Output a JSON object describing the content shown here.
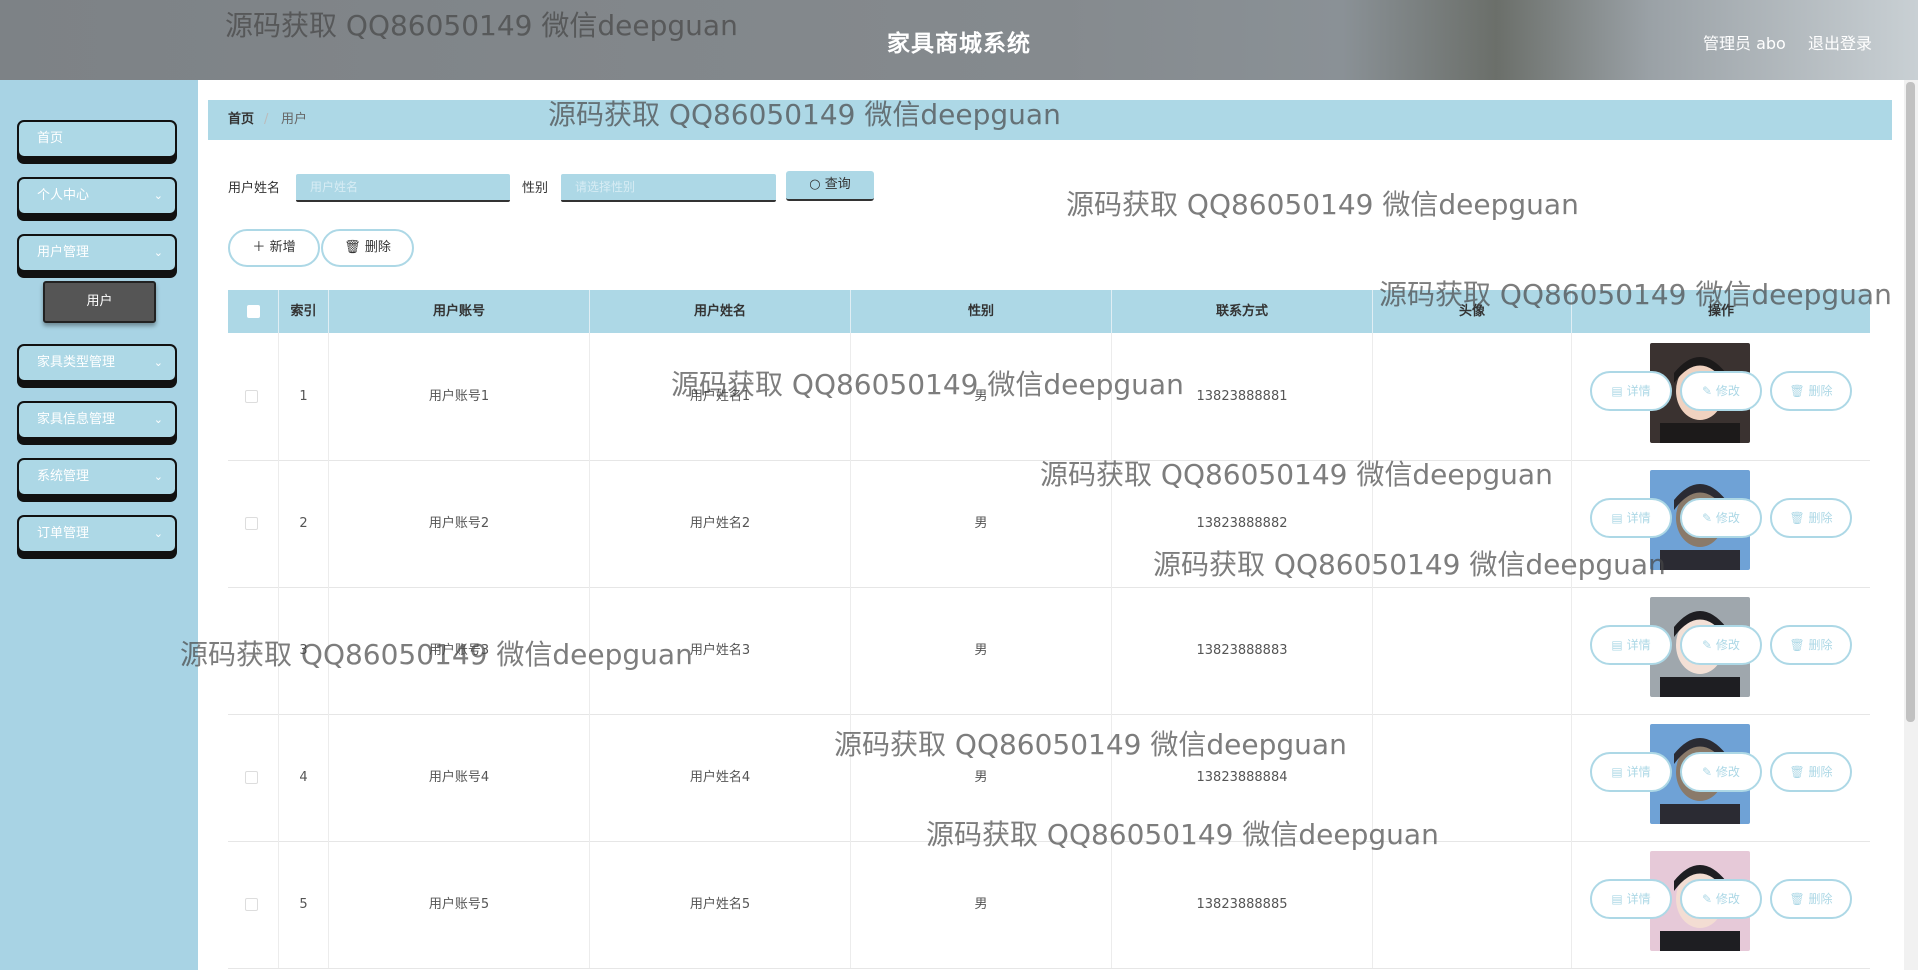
{
  "header": {
    "title": "家具商城系统",
    "user": "管理员 abo",
    "logout": "退出登录"
  },
  "sidebar": {
    "items": [
      {
        "label": "首页",
        "chev": ""
      },
      {
        "label": "个人中心",
        "chev": "⌄"
      },
      {
        "label": "用户管理",
        "chev": "⌄"
      },
      {
        "label": "家具类型管理",
        "chev": "⌄"
      },
      {
        "label": "家具信息管理",
        "chev": "⌄"
      },
      {
        "label": "系统管理",
        "chev": "⌄"
      },
      {
        "label": "订单管理",
        "chev": "⌄"
      }
    ],
    "sub_item": "用户"
  },
  "breadcrumb": {
    "home": "首页",
    "sep": "/",
    "current": "用户"
  },
  "search": {
    "name_label": "用户姓名",
    "name_placeholder": "用户姓名",
    "gender_label": "性别",
    "gender_placeholder": "请选择性别",
    "query_label": "查询"
  },
  "toolbar": {
    "add_label": "新增",
    "delete_label": "删除"
  },
  "table": {
    "headers": [
      "索引",
      "用户账号",
      "用户姓名",
      "性别",
      "联系方式",
      "头像",
      "操作"
    ],
    "rows": [
      {
        "index": "1",
        "account": "用户账号1",
        "name": "用户姓名1",
        "gender": "男",
        "phone": "13823888881"
      },
      {
        "index": "2",
        "account": "用户账号2",
        "name": "用户姓名2",
        "gender": "男",
        "phone": "13823888882"
      },
      {
        "index": "3",
        "account": "用户账号3",
        "name": "用户姓名3",
        "gender": "男",
        "phone": "13823888883"
      },
      {
        "index": "4",
        "account": "用户账号4",
        "name": "用户姓名4",
        "gender": "男",
        "phone": "13823888884"
      },
      {
        "index": "5",
        "account": "用户账号5",
        "name": "用户姓名5",
        "gender": "男",
        "phone": "13823888885"
      }
    ],
    "actions": {
      "detail": "详情",
      "edit": "修改",
      "delete": "删除"
    }
  },
  "watermark": "源码获取 QQ86050149 微信deepguan",
  "colors": {
    "accent": "#add8e6",
    "sidebar": "#a8d3e4"
  }
}
